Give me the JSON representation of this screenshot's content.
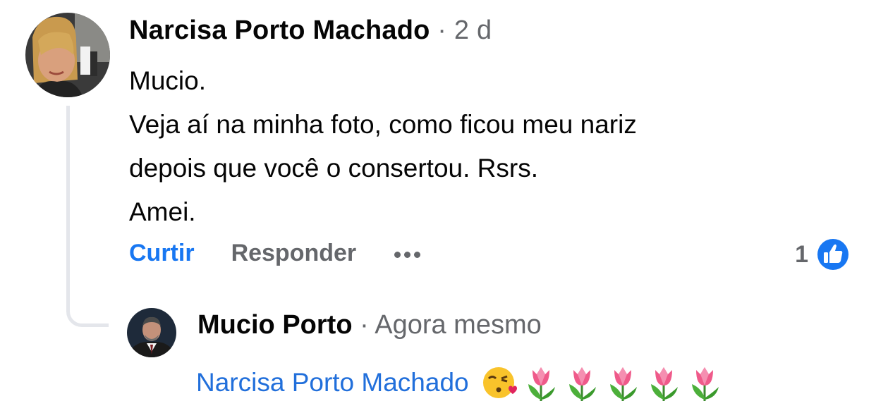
{
  "comment": {
    "author": "Narcisa Porto Machado",
    "time": " · 2 d",
    "text": "Mucio.\nVeja aí na minha foto, como ficou meu nariz\ndepois que você o consertou. Rsrs.\nAmei.",
    "actions": {
      "like_label": "Curtir",
      "reply_label": "Responder"
    },
    "reactions": {
      "count": "1",
      "type": "like-icon",
      "color": "#1877f2"
    }
  },
  "reply": {
    "author": "Mucio Porto",
    "time": " · Agora mesmo",
    "mention": "Narcisa Porto Machado",
    "emojis": [
      "kissing-face-icon",
      "tulip-icon",
      "tulip-icon",
      "tulip-icon",
      "tulip-icon",
      "tulip-icon"
    ]
  },
  "colors": {
    "link_blue": "#1877f2",
    "mention_blue": "#216fdb",
    "muted": "#65676b",
    "thread_line": "#e4e6eb"
  }
}
